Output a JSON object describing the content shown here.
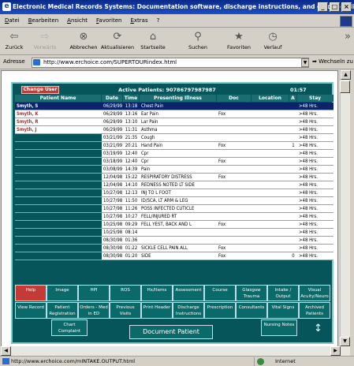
{
  "window": {
    "title": "Electronic Medical Records Systems: Documentation software, discharge instructions, and electro - Micr...",
    "min": "_",
    "max": "□",
    "close": "×"
  },
  "menu": [
    "Datei",
    "Bearbeiten",
    "Ansicht",
    "Favoriten",
    "Extras",
    "?"
  ],
  "toolbar": {
    "back": "Zurück",
    "forward": "Vorwärts",
    "stop": "Abbrechen",
    "refresh": "Aktualisieren",
    "home": "Startseite",
    "search": "Suchen",
    "favorites": "Favoriten",
    "history": "Verlauf",
    "more": "»"
  },
  "address": {
    "label": "Adresse",
    "url": "http://www.erchoice.com/SUPERTOURindex.html",
    "go": "Wechseln zu"
  },
  "app": {
    "change_user": "Change User",
    "active_patients": "Active Patients: 90786797987987",
    "clock": "01:57",
    "columns": [
      "Patient Name",
      "Date",
      "Time",
      "Presenting Illness",
      "Doc",
      "Location",
      "A",
      "Stay"
    ],
    "rows": [
      [
        "Smyth, S",
        "06/29/99",
        "13:18",
        "Chest Pain",
        "",
        "",
        "",
        ">48 Hrs."
      ],
      [
        "Smyth, K",
        "06/29/99",
        "13:16",
        "Ear Pain",
        "Fox",
        "",
        "",
        ">48 Hrs."
      ],
      [
        "Smyth, R",
        "06/29/99",
        "13:10",
        "Lar Pain",
        "",
        "",
        "",
        ">48 Hrs."
      ],
      [
        "Smyth, J",
        "06/29/99",
        "11:31",
        "Asthma",
        "",
        "",
        "",
        ">48 Hrs."
      ],
      [
        "",
        "03/21/99",
        "21:35",
        "Cough",
        "",
        "",
        "",
        ">48 Hrs."
      ],
      [
        "",
        "03/21/99",
        "20:21",
        "Hand Pain",
        "Fox",
        "",
        "1",
        ">48 Hrs."
      ],
      [
        "",
        "03/19/99",
        "12:40",
        "Cpr",
        "",
        "",
        "",
        ">48 Hrs."
      ],
      [
        "",
        "03/18/99",
        "12:40",
        "Cpr",
        "Fox",
        "",
        "",
        ">48 Hrs."
      ],
      [
        "",
        "03/08/99",
        "14:39",
        "Pain",
        "",
        "",
        "",
        ">48 Hrs."
      ],
      [
        "",
        "12/04/98",
        "15:22",
        "RESPIRATORY DISTRESS",
        "Fox",
        "",
        "",
        ">48 Hrs."
      ],
      [
        "",
        "12/04/98",
        "14:10",
        "REDNESS NOTED LT SIDE",
        "",
        "",
        "",
        ">48 Hrs."
      ],
      [
        "",
        "10/27/98",
        "12:13",
        "INJ TO L FOOT",
        "",
        "",
        "",
        ">48 Hrs."
      ],
      [
        "",
        "10/27/98",
        "11:50",
        "ID/SCA, LT ARM & LEG",
        "",
        "",
        "",
        ">48 Hrs."
      ],
      [
        "",
        "10/27/98",
        "11:26",
        "POSS INFECTED CUTICLE",
        "",
        "",
        "",
        ">48 Hrs."
      ],
      [
        "",
        "10/27/98",
        "10:27",
        "FELL/INJURED RT",
        "",
        "",
        "",
        ">48 Hrs."
      ],
      [
        "",
        "10/25/98",
        "09:29",
        "FELL YEST, BACK AND L",
        "Fox",
        "",
        "",
        ">48 Hrs."
      ],
      [
        "",
        "10/25/98",
        "08:14",
        "",
        "",
        "",
        "",
        ">48 Hrs."
      ],
      [
        "",
        "08/30/98",
        "01:36",
        "",
        "",
        "",
        "",
        ">48 Hrs."
      ],
      [
        "",
        "08/30/98",
        "01:22",
        "SICKLE CELL PAIN ALL",
        "Fox",
        "",
        "",
        ">48 Hrs."
      ],
      [
        "",
        "08/30/98",
        "01:20",
        "SIDE",
        "Fox",
        "",
        "0",
        ">48 Hrs."
      ]
    ],
    "buttons_row1": [
      "Help",
      "Image",
      "HPI",
      "ROS",
      "Hx/Items",
      "Assessment",
      "Course",
      "Glasgow Trauma",
      "Intake / Output",
      "Visual Acuity/Neuro"
    ],
    "buttons_row2": [
      "View Record",
      "Patient Registration",
      "Orders - Med in ED",
      "Previous Visits",
      "Print Header",
      "Discharge Instructions",
      "Prescription",
      "Consultants",
      "Vital Signs",
      "Archived Patients"
    ],
    "buttons_row3": [
      "Chart Complaint",
      "Nursing Notes"
    ],
    "document_patient": "Document Patient"
  },
  "status": {
    "url": "http://www.erchoice.com/mINTAKE.OUTPUT.html",
    "zone": "Internet"
  }
}
